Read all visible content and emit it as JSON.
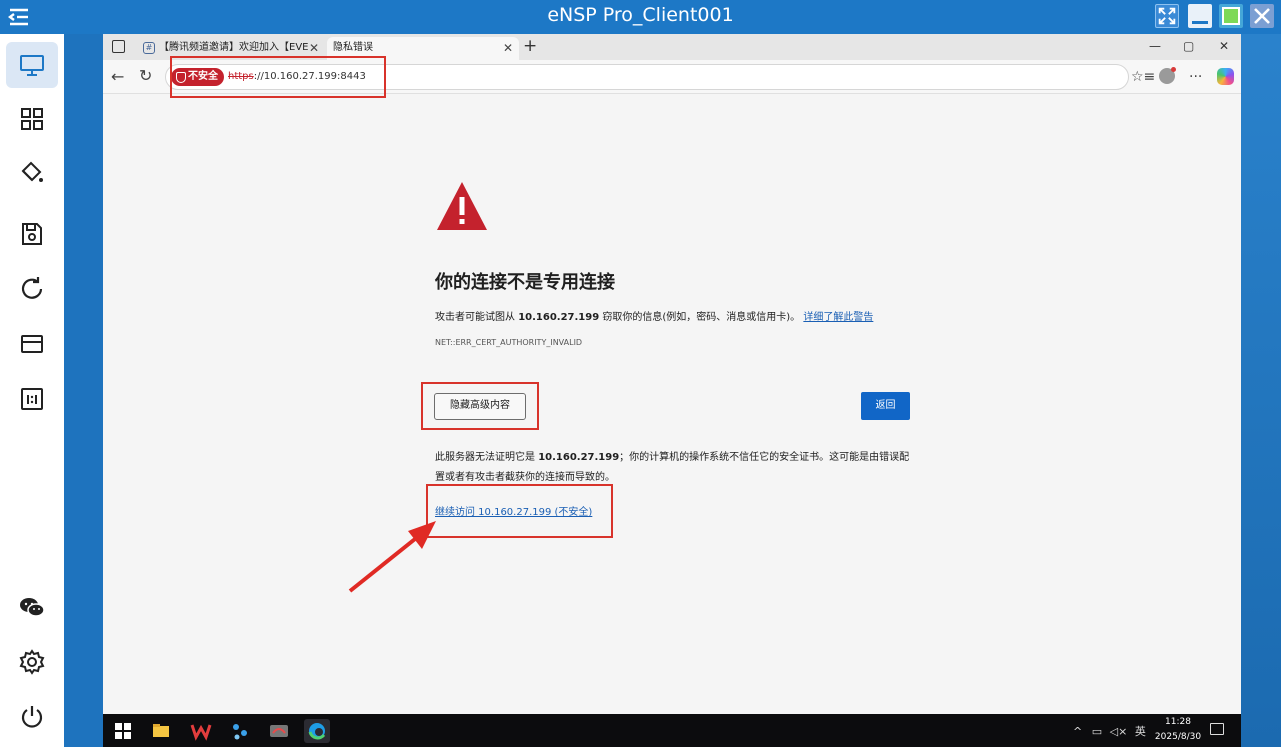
{
  "window": {
    "title": "eNSP Pro_Client001"
  },
  "sidebar": {
    "items": [
      {
        "name": "monitor-icon",
        "active": true
      },
      {
        "name": "grid-icon"
      },
      {
        "name": "paint-bucket-icon"
      },
      {
        "name": "save-icon"
      },
      {
        "name": "refresh-icon"
      },
      {
        "name": "card-icon"
      },
      {
        "name": "ratio-icon"
      },
      {
        "name": "wechat-icon"
      },
      {
        "name": "settings-icon"
      },
      {
        "name": "power-icon"
      }
    ]
  },
  "browser": {
    "tabs": [
      {
        "label": "【腾讯频道邀请】欢迎加入【EVE"
      },
      {
        "label": "隐私错误",
        "active": true
      }
    ],
    "address": {
      "security_label": "不安全",
      "url_scheme": "https",
      "url_rest": "://10.160.27.199:8443"
    }
  },
  "page": {
    "heading": "你的连接不是专用连接",
    "desc_prefix": "攻击者可能试图从",
    "desc_host": "10.160.27.199",
    "desc_suffix": "窃取你的信息(例如，密码、消息或信用卡)。",
    "learn_more": "详细了解此警告",
    "error_code": "NET::ERR_CERT_AUTHORITY_INVALID",
    "hide_button": "隐藏高级内容",
    "back_button": "返回",
    "advanced_prefix": "此服务器无法证明它是",
    "advanced_host": "10.160.27.199",
    "advanced_suffix": "；你的计算机的操作系统不信任它的安全证书。这可能是由错误配置或者有攻击者截获你的连接而导致的。",
    "proceed_link": "继续访问 10.160.27.199 (不安全)"
  },
  "taskbar": {
    "ime": "英",
    "time": "11:28",
    "date": "2025/8/30"
  },
  "colors": {
    "titlebar": "#1d78c6",
    "annotation_red": "#d8332b",
    "link": "#1a5fb4",
    "primary_button": "#1166c7",
    "warning_red": "#c4222d"
  }
}
